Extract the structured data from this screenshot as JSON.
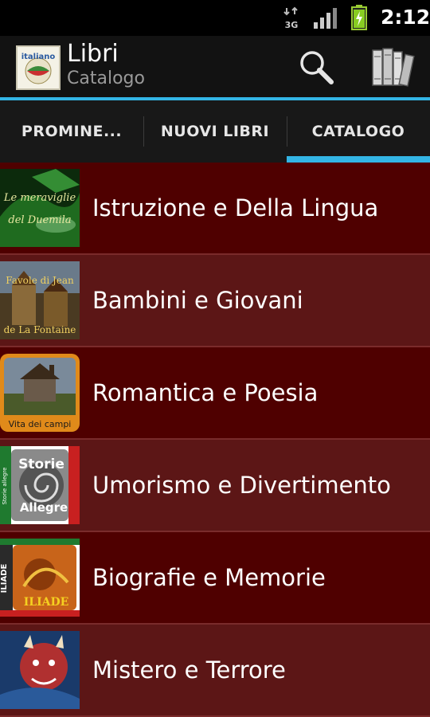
{
  "status_bar": {
    "network": "3G",
    "time": "2:12",
    "icons": [
      "3g-data-icon",
      "signal-icon",
      "battery-charging-icon"
    ]
  },
  "action_bar": {
    "title": "Libri",
    "subtitle": "Catalogo",
    "logo_text": "italiano",
    "icons": [
      "app-logo-icon",
      "search-icon",
      "library-books-icon"
    ]
  },
  "tabs": [
    {
      "label": "PROMINE..."
    },
    {
      "label": "NUOVI LIBRI"
    },
    {
      "label": "CATALOGO",
      "selected": true
    }
  ],
  "categories": [
    {
      "label": "Istruzione e Della Lingua",
      "thumb_text": [
        "Le meraviglie",
        "del Duemila"
      ]
    },
    {
      "label": "Bambini e Giovani",
      "thumb_text": [
        "Favole di Jean",
        "de La Fontaine"
      ]
    },
    {
      "label": "Romantica e Poesia",
      "thumb_text": [
        "Vita dei campi"
      ]
    },
    {
      "label": "Umorismo e Divertimento",
      "thumb_text": [
        "Storie",
        "Allegre",
        "Storie allegre"
      ]
    },
    {
      "label": "Biografie e Memorie",
      "thumb_text": [
        "ILIADE",
        "ILIADE"
      ]
    },
    {
      "label": "Mistero e Terrore",
      "thumb_text": []
    }
  ],
  "colors": {
    "accent": "#33b5e5",
    "row_dark": "#4f0000",
    "row_light": "#5c1616",
    "action_bar": "#121212"
  }
}
